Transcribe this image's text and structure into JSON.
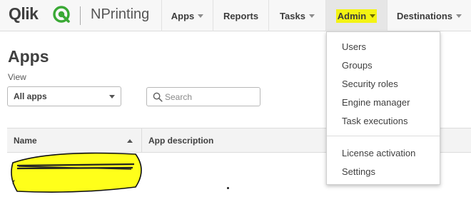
{
  "brand": {
    "logo_text": "Qlik",
    "product_name": "NPrinting"
  },
  "nav": {
    "apps": "Apps",
    "reports": "Reports",
    "tasks": "Tasks",
    "admin": "Admin",
    "destinations": "Destinations"
  },
  "page": {
    "title": "Apps",
    "view_label": "View",
    "view_selected": "All apps",
    "search_placeholder": "Search"
  },
  "table": {
    "columns": [
      "Name",
      "App description"
    ],
    "sort_column": "Name",
    "sort_direction": "ascending"
  },
  "admin_menu": {
    "items": [
      "Users",
      "Groups",
      "Security roles",
      "Engine manager",
      "Task executions"
    ],
    "items_after_separator": [
      "License activation",
      "Settings"
    ]
  },
  "colors": {
    "logo_green": "#3aa935",
    "highlight_yellow": "#f3f313",
    "redaction_yellow": "#ffff1a",
    "navbar_bg": "#f7f7f7"
  },
  "icons": {
    "search": "search-icon",
    "caret": "caret-down-icon",
    "sort": "sort-ascending-icon"
  }
}
